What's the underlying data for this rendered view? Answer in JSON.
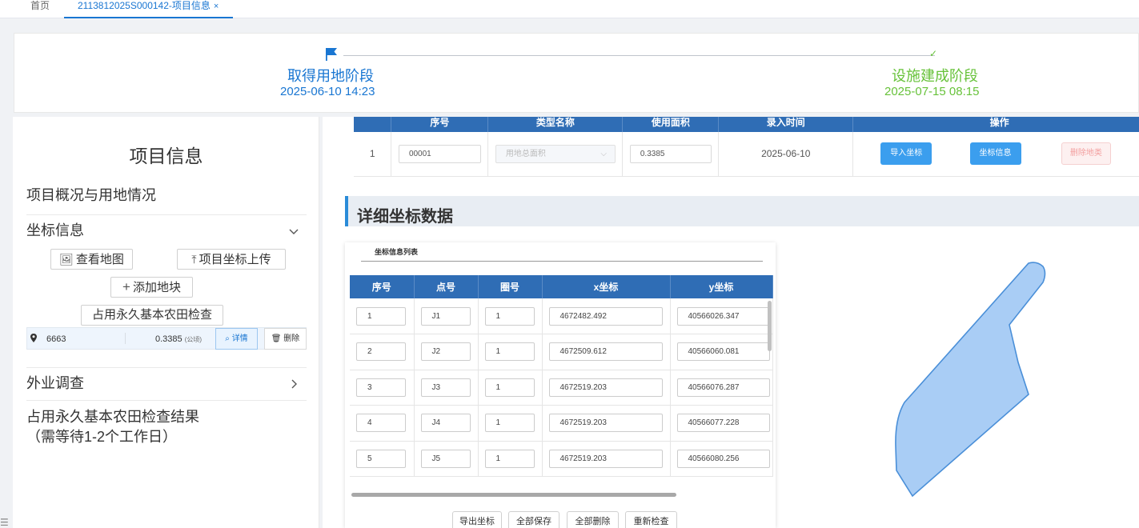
{
  "tabs": {
    "home": "首页",
    "active": "2113812025S000142-项目信息",
    "close": "×"
  },
  "stages": {
    "start_title": "取得用地阶段",
    "start_date": "2025-06-10 14:23",
    "end_title": "设施建成阶段",
    "end_date": "2025-07-15 08:15"
  },
  "sidebar": {
    "title": "项目信息",
    "overview": "项目概况与用地情况",
    "coords_section": "坐标信息",
    "view_map": "查看地图",
    "upload_coords": "项目坐标上传",
    "add_plot": "添加地块",
    "farmland_check": "占用永久基本农田检查",
    "plot": {
      "id": "6663",
      "area": "0.3385",
      "unit": "(公顷)",
      "detail": "详情",
      "delete": "删除"
    },
    "field_survey": "外业调查",
    "result_line1": "占用永久基本农田检查结果",
    "result_line2": "（需等待1-2个工作日）"
  },
  "type_table": {
    "headers": [
      "序号",
      "类型名称",
      "使用面积",
      "录入时间",
      "操作"
    ],
    "row": {
      "index": "1",
      "code": "00001",
      "type_placeholder": "用地总面积",
      "area": "0.3385",
      "date": "2025-06-10",
      "import_btn": "导入坐标",
      "info_btn": "坐标信息",
      "delete_btn": "删除地类"
    }
  },
  "detail_section": {
    "title": "详细坐标数据"
  },
  "coord_card": {
    "title": "坐标信息列表",
    "headers": [
      "序号",
      "点号",
      "圈号",
      "x坐标",
      "y坐标"
    ],
    "rows": [
      {
        "idx": "1",
        "point": "J1",
        "ring": "1",
        "x": "4672482.492",
        "y": "40566026.347"
      },
      {
        "idx": "2",
        "point": "J2",
        "ring": "1",
        "x": "4672509.612",
        "y": "40566060.081"
      },
      {
        "idx": "3",
        "point": "J3",
        "ring": "1",
        "x": "4672519.203",
        "y": "40566076.287"
      },
      {
        "idx": "4",
        "point": "J4",
        "ring": "1",
        "x": "4672519.203",
        "y": "40566077.228"
      },
      {
        "idx": "5",
        "point": "J5",
        "ring": "1",
        "x": "4672519.203",
        "y": "40566080.256"
      }
    ],
    "buttons": {
      "export": "导出坐标",
      "save_all": "全部保存",
      "delete_all": "全部删除",
      "recheck": "重新检查"
    }
  },
  "colors": {
    "primary": "#1976d2",
    "success": "#67c23a",
    "table_header": "#2f6db5",
    "polygon_fill": "#a9cdf5",
    "polygon_stroke": "#4a8fd8"
  }
}
